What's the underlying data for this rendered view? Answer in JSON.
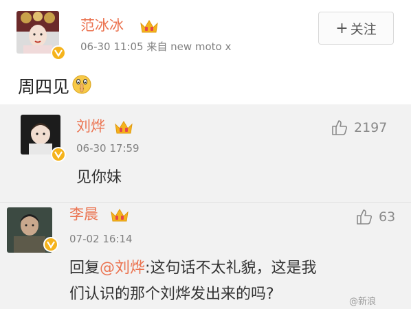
{
  "post": {
    "author": "范冰冰",
    "meta": "06-30 11:05  来自 new moto x",
    "follow_label": "关注",
    "follow_plus": "+",
    "text": "周四见",
    "emoji": "shh-emoji-icon"
  },
  "comments": [
    {
      "author": "刘烨",
      "time": "06-30 17:59",
      "text": "见你妹",
      "likes": "2197"
    },
    {
      "author": "李晨",
      "time": "07-02 16:14",
      "reply_prefix": "回复",
      "mention": "@刘烨",
      "text_line1": ":这句话不太礼貌，这是我",
      "text_line2": "们认识的那个刘烨发出来的吗?",
      "likes": "63"
    }
  ],
  "watermark": "@新浪",
  "colors": {
    "name": "#eb7350",
    "badge": "#f5b31c",
    "comment_bg": "#f2f2f2",
    "meta": "#808080"
  }
}
